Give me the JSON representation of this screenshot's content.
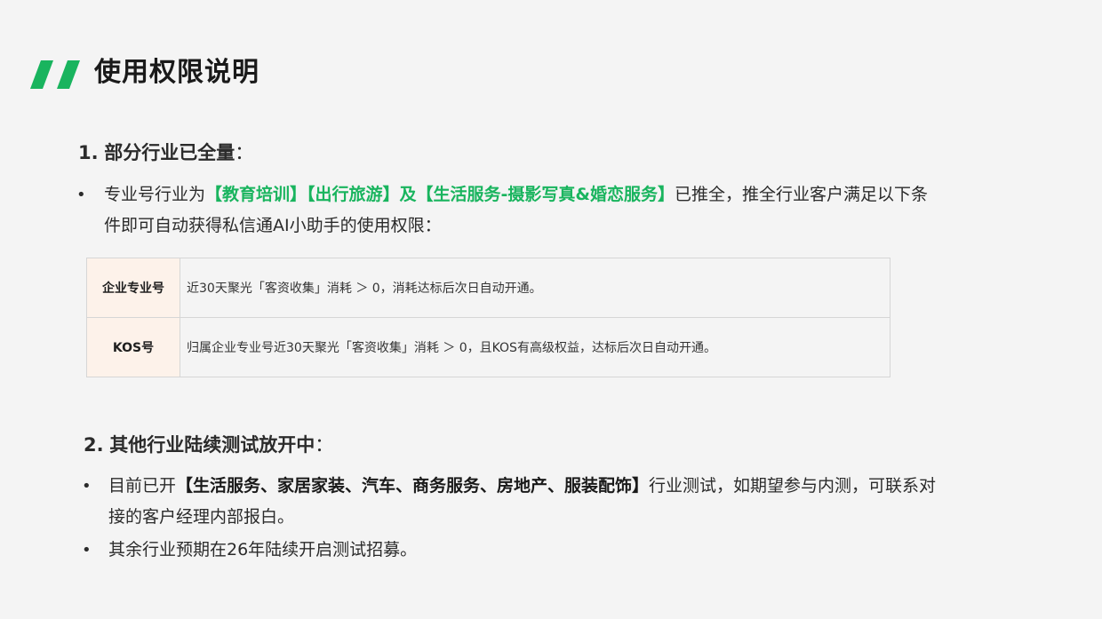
{
  "page_title": "使用权限说明",
  "colors": {
    "accent_green": "#19b45e",
    "label_cell_bg": "#fdf2ea",
    "page_bg": "#f4f4f4"
  },
  "section1": {
    "number": "1.",
    "title": "部分行业已全量",
    "colon": "：",
    "bullet": {
      "lead": "专业号行业为",
      "highlight": "【教育培训】【出行旅游】及【生活服务-摄影写真&婚恋服务】",
      "tail_line1": "已推全，推全行业客户满足以下条",
      "tail_line2": "件即可自动获得私信通AI小助手的使用权限："
    },
    "table": [
      {
        "label": "企业专业号",
        "desc": "近30天聚光「客资收集」消耗 ＞ 0，消耗达标后次日自动开通。"
      },
      {
        "label": "KOS号",
        "desc": "归属企业专业号近30天聚光「客资收集」消耗 ＞ 0，且KOS有高级权益，达标后次日自动开通。"
      }
    ]
  },
  "section2": {
    "number": "2.",
    "title": "其他行业陆续测试放开中",
    "colon": "：",
    "bullet1": {
      "lead": "目前已开",
      "highlight": "【生活服务、家居家装、汽车、商务服务、房地产、服装配饰】",
      "tail_line1": "行业测试，如期望参与内测，可联系对",
      "tail_line2": "接的客户经理内部报白。"
    },
    "bullet2": {
      "text": "其余行业预期在26年陆续开启测试招募。"
    }
  },
  "bullet_glyph": "•"
}
